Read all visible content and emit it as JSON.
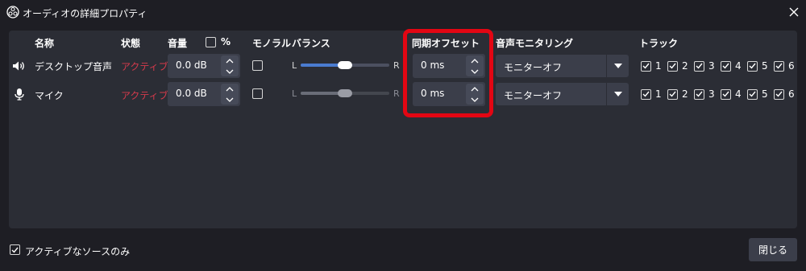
{
  "window": {
    "title": "オーディオの詳細プロパティ"
  },
  "headers": {
    "name": "名称",
    "status": "状態",
    "volume": "音量",
    "percent": "%",
    "mono": "モノラル",
    "balance": "バランス",
    "sync_offset": "同期オフセット",
    "monitoring": "音声モニタリング",
    "tracks": "トラック"
  },
  "balance_labels": {
    "left": "L",
    "right": "R"
  },
  "rows": [
    {
      "icon": "speaker-icon",
      "name": "デスクトップ音声",
      "status": "アクティブ",
      "volume": "0.0 dB",
      "mono": false,
      "balance": 0.5,
      "sync_offset": "0 ms",
      "monitoring": "モニターオフ",
      "tracks": [
        {
          "label": "1",
          "checked": true
        },
        {
          "label": "2",
          "checked": true
        },
        {
          "label": "3",
          "checked": true
        },
        {
          "label": "4",
          "checked": true
        },
        {
          "label": "5",
          "checked": true
        },
        {
          "label": "6",
          "checked": true
        }
      ]
    },
    {
      "icon": "microphone-icon",
      "name": "マイク",
      "status": "アクティブ",
      "volume": "0.0 dB",
      "mono": false,
      "balance": 0.5,
      "sync_offset": "0 ms",
      "monitoring": "モニターオフ",
      "tracks": [
        {
          "label": "1",
          "checked": true
        },
        {
          "label": "2",
          "checked": true
        },
        {
          "label": "3",
          "checked": true
        },
        {
          "label": "4",
          "checked": true
        },
        {
          "label": "5",
          "checked": true
        },
        {
          "label": "6",
          "checked": true
        }
      ]
    }
  ],
  "footer": {
    "active_only_label": "アクティブなソースのみ",
    "active_only_checked": true,
    "close_button": "閉じる"
  },
  "colors": {
    "background": "#1e1e24",
    "panel": "#2b2d35",
    "status_active": "#d53a4c",
    "slider_active": "#4a7bd0",
    "highlight": "#e30613"
  }
}
